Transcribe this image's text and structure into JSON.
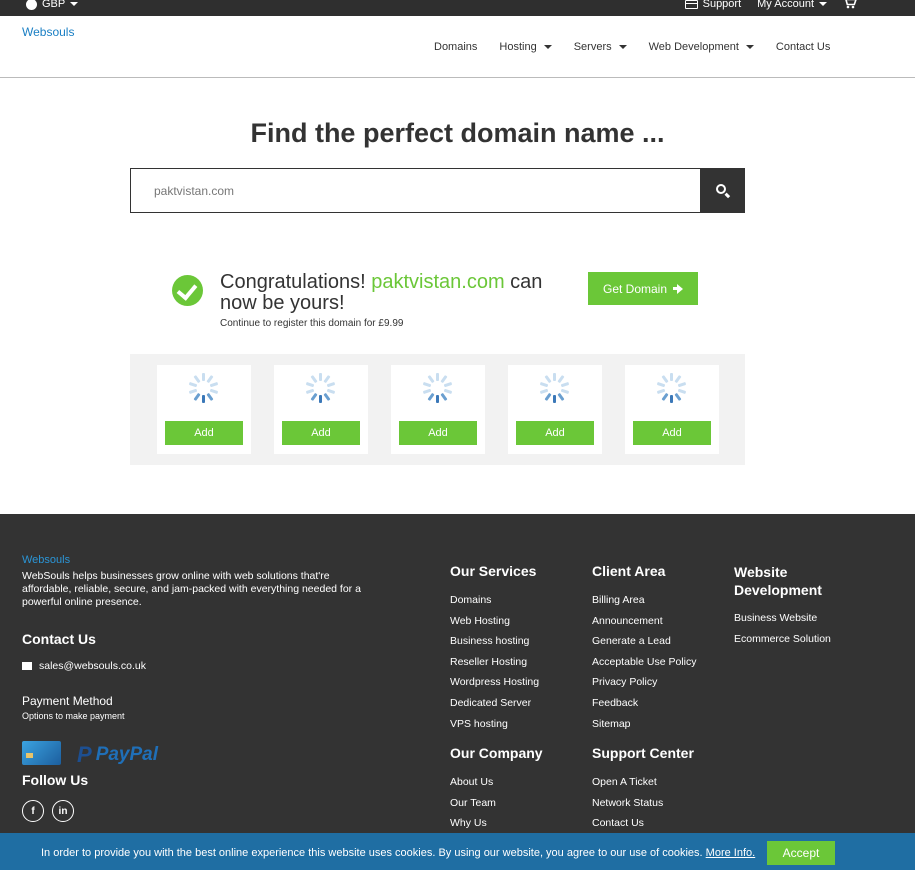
{
  "topbar": {
    "currency": "GBP",
    "support": "Support",
    "account": "My Account"
  },
  "header": {
    "logo": "Websouls",
    "nav": [
      "Domains",
      "Hosting",
      "Servers",
      "Web Development",
      "Contact Us"
    ]
  },
  "hero": {
    "title": "Find the perfect domain name ...",
    "search_value": "paktvistan.com"
  },
  "result": {
    "congrats_prefix": "Congratulations!",
    "domain": "paktvistan.com",
    "congrats_suffix_1": "can",
    "congrats_suffix_2": "now be yours!",
    "sub": "Continue to register this domain for £9.99",
    "cta": "Get Domain"
  },
  "suggestions": {
    "add_label": "Add",
    "count": 5
  },
  "footer": {
    "brand": "Websouls",
    "about": "WebSouls helps businesses grow online with web solutions that're affordable, reliable, secure, and jam-packed with everything needed for a powerful online presence.",
    "contact_heading": "Contact Us",
    "email": "sales@websouls.co.uk",
    "payment_heading": "Payment Method",
    "payment_sub": "Options to make payment",
    "paypal": "PayPal",
    "follow_heading": "Follow Us",
    "social": [
      "f",
      "in"
    ],
    "services_heading": "Our Services",
    "services": [
      "Domains",
      "Web Hosting",
      "Business hosting",
      "Reseller Hosting",
      "Wordpress Hosting",
      "Dedicated Server",
      "VPS hosting"
    ],
    "client_heading": "Client Area",
    "client": [
      "Billing Area",
      "Announcement",
      "Generate a Lead",
      "Acceptable Use Policy",
      "Privacy Policy",
      "Feedback",
      "Sitemap"
    ],
    "webdev_heading_1": "Website",
    "webdev_heading_2": "Development",
    "webdev": [
      "Business Website",
      "Ecommerce Solution"
    ],
    "company_heading": "Our Company",
    "company": [
      "About Us",
      "Our Team",
      "Why Us"
    ],
    "support_heading": "Support Center",
    "support": [
      "Open A Ticket",
      "Network Status",
      "Contact Us"
    ]
  },
  "cookie": {
    "text": "In order to provide you with the best online experience this website uses cookies. By using our website, you agree to our use of cookies.",
    "more": "More Info.",
    "accept": "Accept"
  },
  "colors": {
    "accent_green": "#6bc738",
    "brand_blue": "#1a7fc4",
    "footer_bg": "#333333",
    "cookie_bg": "#1f6ea3"
  }
}
